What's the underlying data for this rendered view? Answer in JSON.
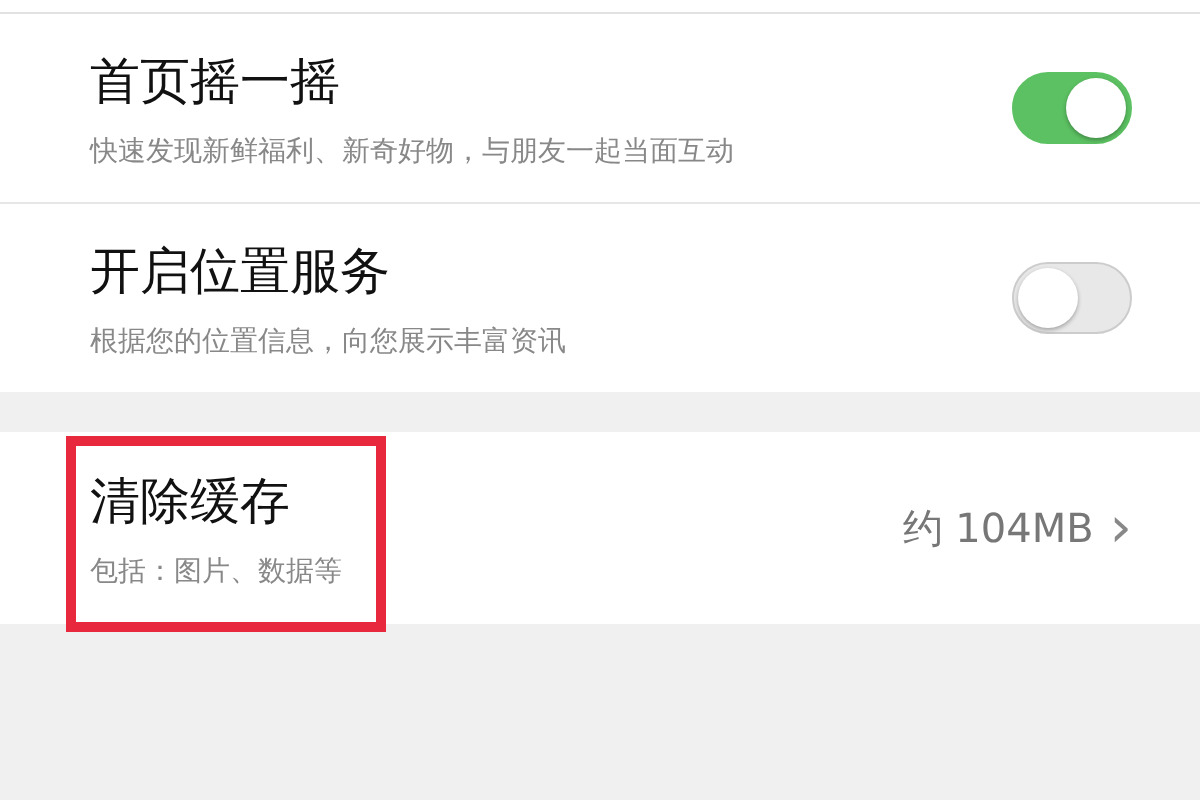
{
  "settings": [
    {
      "kind": "toggle",
      "title": "首页摇一摇",
      "subtitle": "快速发现新鲜福利、新奇好物，与朋友一起当面互动",
      "on": true
    },
    {
      "kind": "toggle",
      "title": "开启位置服务",
      "subtitle": "根据您的位置信息，向您展示丰富资讯",
      "on": false
    }
  ],
  "cache": {
    "title": "清除缓存",
    "subtitle": "包括：图片、数据等",
    "value": "约 104MB",
    "chevron": "›",
    "highlighted": true
  }
}
